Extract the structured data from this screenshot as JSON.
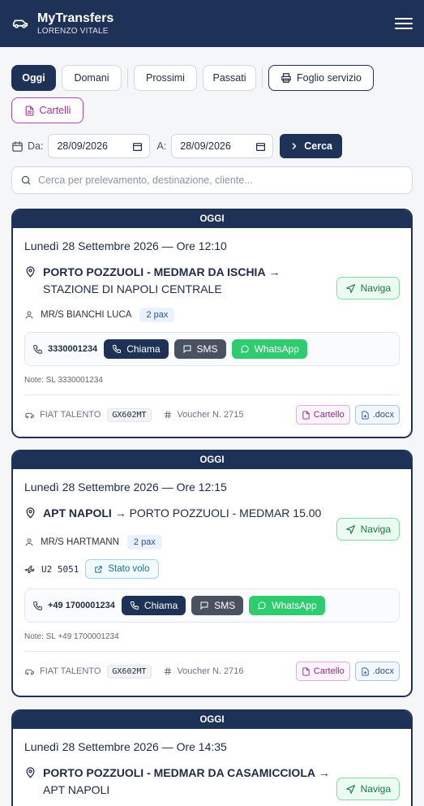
{
  "header": {
    "app_title": "MyTransfers",
    "user_name": "LORENZO VITALE",
    "logo_icon": "car-icon",
    "menu_icon": "hamburger-menu-icon"
  },
  "tabs": {
    "oggi": "Oggi",
    "domani": "Domani",
    "prossimi": "Prossimi",
    "passati": "Passati",
    "foglio_servizio": "Foglio servizio",
    "cartelli": "Cartelli"
  },
  "filters": {
    "from_label": "Da:",
    "from_value": "28/09/2026",
    "to_label": "A:",
    "to_value": "28/09/2026",
    "search_button": "Cerca",
    "search_placeholder": "Cerca per prelevamento, destinazione, cliente..."
  },
  "labels": {
    "naviga": "Naviga",
    "chiama": "Chiama",
    "sms": "SMS",
    "whatsapp": "WhatsApp",
    "cartello": "Cartello",
    "docx": ".docx",
    "stato_volo": "Stato volo"
  },
  "colors": {
    "primary": "#1e3257",
    "whatsapp": "#2ecc6f",
    "naviga": "#1a7a3d",
    "cartello": "#8b2a87"
  },
  "transfers": [
    {
      "header": "OGGI",
      "when": "Lunedì 28 Settembre 2026 — Ore 12:10",
      "from": "PORTO POZZUOLI - MEDMAR DA ISCHIA",
      "arrow": "→",
      "to": "STAZIONE DI NAPOLI CENTRALE",
      "passenger": "MR/S BIANCHI LUCA",
      "pax": "2 pax",
      "phone": "3330001234",
      "note": "Note: SL 3330001234",
      "vehicle": "FIAT TALENTO",
      "plate": "GX602MT",
      "voucher": "Voucher N. 2715"
    },
    {
      "header": "OGGI",
      "when": "Lunedì 28 Settembre 2026 — Ore 12:15",
      "from": "APT NAPOLI",
      "arrow": "→",
      "to": "PORTO POZZUOLI - MEDMAR 15.00",
      "passenger": "MR/S HARTMANN",
      "pax": "2 pax",
      "flight": "U2 5051",
      "phone": "+49 1700001234",
      "note": "Note: SL +49 1700001234",
      "vehicle": "FIAT TALENTO",
      "plate": "GX602MT",
      "voucher": "Voucher N. 2716"
    },
    {
      "header": "OGGI",
      "when": "Lunedì 28 Settembre 2026 — Ore 14:35",
      "from": "PORTO POZZUOLI - MEDMAR DA CASAMICCIOLA",
      "arrow": "→",
      "to": "APT NAPOLI"
    }
  ]
}
